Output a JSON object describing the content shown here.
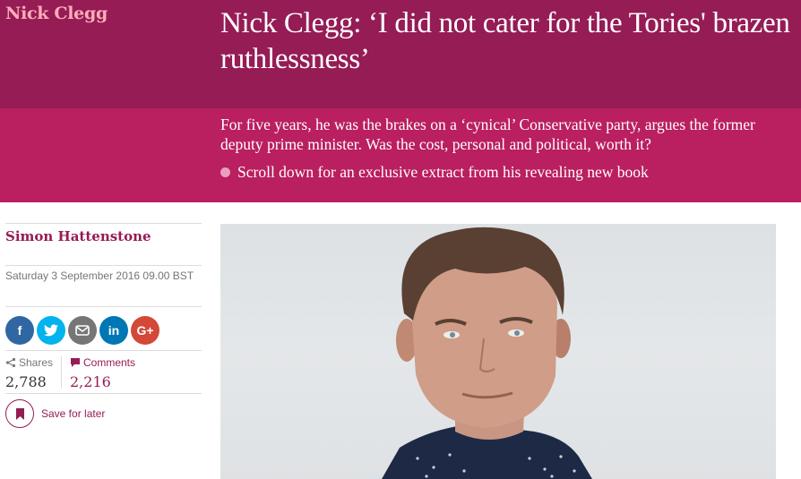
{
  "section": {
    "kicker": "Nick Clegg"
  },
  "headline": "Nick Clegg: ‘I did not cater for the Tories' brazen ruthlessness’",
  "standfirst": "For five years, he was the brakes on a ‘cynical’ Conservative party, argues the former deputy prime minister. Was the cost, personal and political, worth it?",
  "bullet": "Scroll down for an exclusive extract from his revealing new book",
  "byline": "Simon Hattenstone",
  "dateline": "Saturday 3 September 2016 09.00 BST",
  "share": {
    "buttons": [
      {
        "icon": "facebook-icon",
        "glyph": "f"
      },
      {
        "icon": "twitter-icon",
        "glyph": "t"
      },
      {
        "icon": "email-icon",
        "glyph": "✉"
      },
      {
        "icon": "linkedin-icon",
        "glyph": "in"
      },
      {
        "icon": "googleplus-icon",
        "glyph": "G+"
      }
    ]
  },
  "stats": {
    "shares_label": "Shares",
    "shares_count": "2,788",
    "comments_label": "Comments",
    "comments_count": "2,216"
  },
  "save": {
    "label": "Save for later"
  },
  "colors": {
    "header_dark": "#951c55",
    "header_light": "#ba1f5f",
    "kicker": "#fdadba",
    "accent": "#951c55"
  }
}
